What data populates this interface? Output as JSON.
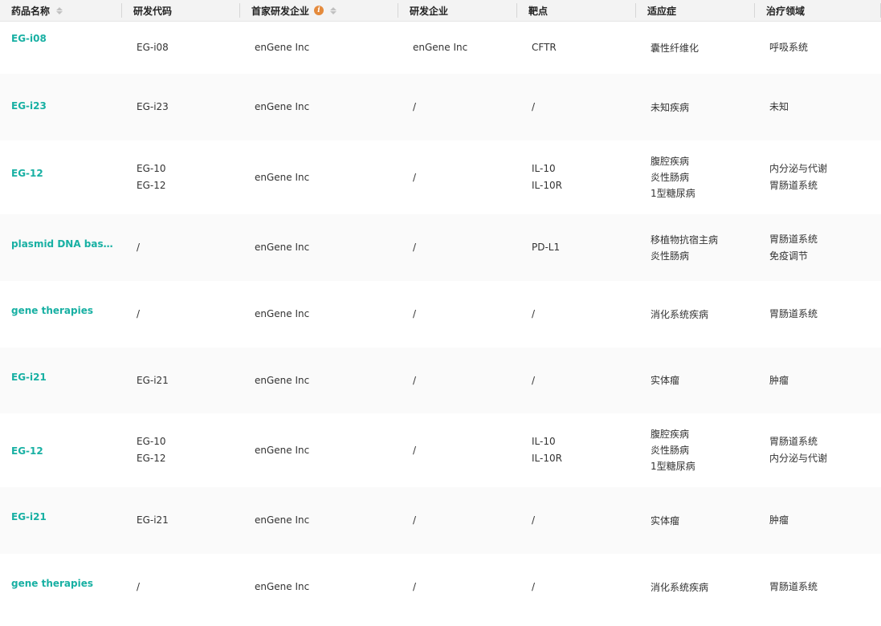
{
  "header": {
    "drug_name": "药品名称",
    "code": "研发代码",
    "first_company": "首家研发企业",
    "company": "研发企业",
    "target": "靶点",
    "indication": "适应症",
    "area": "治疗领域"
  },
  "rows": [
    {
      "drug": "EG-i08",
      "codes": [
        "EG-i08"
      ],
      "first_company": "enGene Inc",
      "company": "enGene Inc",
      "targets": [
        "CFTR"
      ],
      "indications": [
        "囊性纤维化"
      ],
      "areas": [
        "呼吸系统"
      ]
    },
    {
      "drug": "EG-i23",
      "codes": [
        "EG-i23"
      ],
      "first_company": "enGene Inc",
      "company": "/",
      "targets": [
        "/"
      ],
      "indications": [
        "未知疾病"
      ],
      "areas": [
        "未知"
      ]
    },
    {
      "drug": "EG-12",
      "codes": [
        "EG-10",
        "EG-12"
      ],
      "first_company": "enGene Inc",
      "company": "/",
      "targets": [
        "IL-10",
        "IL-10R"
      ],
      "indications": [
        "腹腔疾病",
        "炎性肠病",
        "1型糖尿病"
      ],
      "areas": [
        "内分泌与代谢",
        "胃肠道系统"
      ]
    },
    {
      "drug": "plasmid DNA base...",
      "codes": [
        "/"
      ],
      "first_company": "enGene Inc",
      "company": "/",
      "targets": [
        "PD-L1"
      ],
      "indications": [
        "移植物抗宿主病",
        "炎性肠病"
      ],
      "areas": [
        "胃肠道系统",
        "免疫调节"
      ]
    },
    {
      "drug": "gene therapies",
      "codes": [
        "/"
      ],
      "first_company": "enGene Inc",
      "company": "/",
      "targets": [
        "/"
      ],
      "indications": [
        "消化系统疾病"
      ],
      "areas": [
        "胃肠道系统"
      ]
    },
    {
      "drug": "EG-i21",
      "codes": [
        "EG-i21"
      ],
      "first_company": "enGene Inc",
      "company": "/",
      "targets": [
        "/"
      ],
      "indications": [
        "实体瘤"
      ],
      "areas": [
        "肿瘤"
      ]
    },
    {
      "drug": "EG-12",
      "codes": [
        "EG-10",
        "EG-12"
      ],
      "first_company": "enGene Inc",
      "company": "/",
      "targets": [
        "IL-10",
        "IL-10R"
      ],
      "indications": [
        "腹腔疾病",
        "炎性肠病",
        "1型糖尿病"
      ],
      "areas": [
        "胃肠道系统",
        "内分泌与代谢"
      ]
    },
    {
      "drug": "EG-i21",
      "codes": [
        "EG-i21"
      ],
      "first_company": "enGene Inc",
      "company": "/",
      "targets": [
        "/"
      ],
      "indications": [
        "实体瘤"
      ],
      "areas": [
        "肿瘤"
      ]
    },
    {
      "drug": "gene therapies",
      "codes": [
        "/"
      ],
      "first_company": "enGene Inc",
      "company": "/",
      "targets": [
        "/"
      ],
      "indications": [
        "消化系统疾病"
      ],
      "areas": [
        "胃肠道系统"
      ]
    }
  ]
}
